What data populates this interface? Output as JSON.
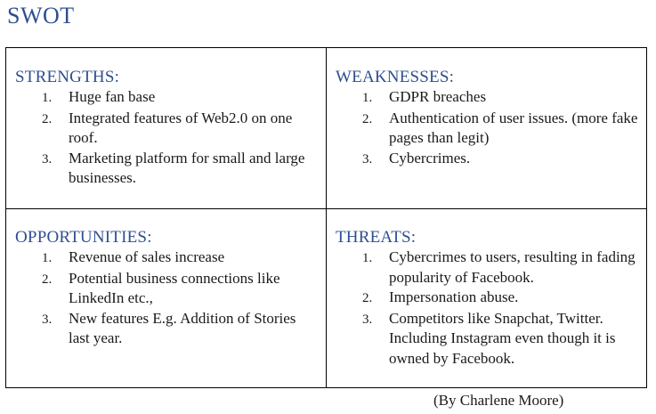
{
  "title": "SWOT",
  "quadrants": {
    "strengths": {
      "heading": "STRENGTHS:",
      "items": [
        {
          "num": "1.",
          "text": "Huge fan base"
        },
        {
          "num": "2.",
          "text": "Integrated features of Web2.0 on one roof."
        },
        {
          "num": "3.",
          "text": "Marketing platform for small and large businesses."
        }
      ]
    },
    "weaknesses": {
      "heading": "WEAKNESSES:",
      "items": [
        {
          "num": "1.",
          "text": "GDPR breaches"
        },
        {
          "num": "2.",
          "text": "Authentication of user issues. (more fake pages than legit)"
        },
        {
          "num": "3.",
          "text": "Cybercrimes."
        }
      ]
    },
    "opportunities": {
      "heading": "OPPORTUNITIES:",
      "items": [
        {
          "num": "1.",
          "text": "Revenue of sales increase"
        },
        {
          "num": "2.",
          "text": "Potential business connections like LinkedIn etc.,"
        },
        {
          "num": "3.",
          "text": "New features E.g. Addition of Stories last year."
        }
      ]
    },
    "threats": {
      "heading": "THREATS:",
      "items": [
        {
          "num": "1.",
          "text": "Cybercrimes to users, resulting in fading popularity of Facebook."
        },
        {
          "num": "2.",
          "text": "Impersonation abuse."
        },
        {
          "num": "3.",
          "text": "Competitors like Snapchat, Twitter.  Including Instagram even though it is owned by Facebook."
        }
      ]
    }
  },
  "credit": "(By Charlene Moore)",
  "colors": {
    "heading": "#2e4f8f",
    "text": "#1a1a1a",
    "border": "#000000"
  }
}
